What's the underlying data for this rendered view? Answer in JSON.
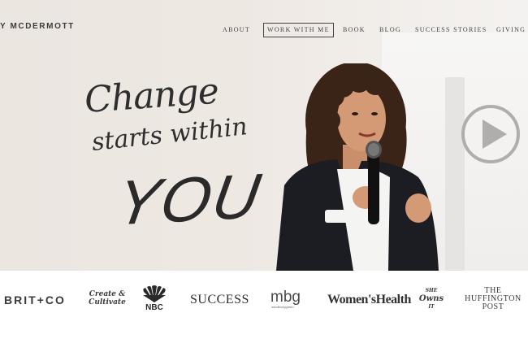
{
  "header": {
    "brand": "Y MCDERMOTT",
    "nav": [
      {
        "label": "ABOUT",
        "active": false
      },
      {
        "label": "WORK WITH ME",
        "active": true
      },
      {
        "label": "BOOK",
        "active": false
      },
      {
        "label": "BLOG",
        "active": false
      },
      {
        "label": "SUCCESS STORIES",
        "active": false
      },
      {
        "label": "GIVING B",
        "active": false
      }
    ]
  },
  "hero": {
    "headline_line1": "Change",
    "headline_line2": "starts within",
    "headline_line3": "YOU",
    "play_icon": "play-circle-icon"
  },
  "logos": {
    "brit": "BRIT+CO",
    "creative_line1": "Create &",
    "creative_line2": "Cultivate",
    "nbc": "NBC",
    "success": "SUCCESS",
    "mbg": "mbg",
    "mbg_sub": "mindbodygreen",
    "womens_health": "Women'sHealth",
    "she_owns_line1": "SHE",
    "she_owns_line2": "Owns",
    "she_owns_line3": "IT",
    "huff_line1": "THE",
    "huff_line2": "HUFFINGTON",
    "huff_line3": "POST"
  },
  "colors": {
    "text": "#3b3b3b",
    "hero_bg": "#ece6e1",
    "play": "#b0aeac"
  }
}
